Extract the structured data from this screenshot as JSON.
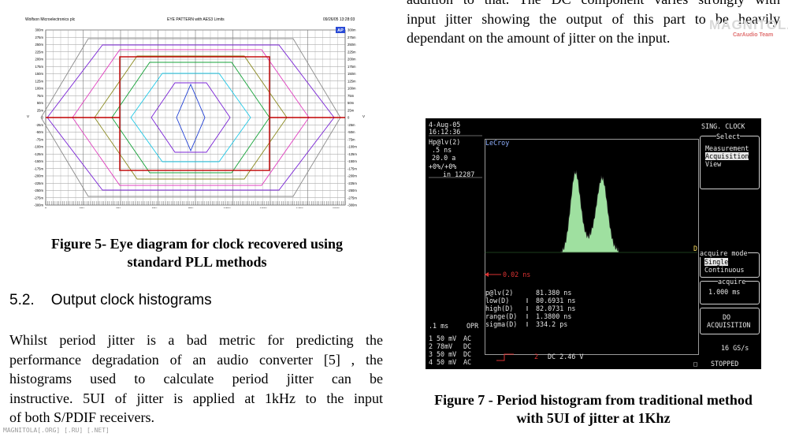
{
  "eye_diagram": {
    "header_left": "Wolfson Microelectronics plc",
    "header_center": "EYE PATTERN with AES3 Limits",
    "header_right": "09/26/05 13:28:03",
    "logo": "AP",
    "y_left_ticks": [
      "300m",
      "275m",
      "250m",
      "225m",
      "200m",
      "175m",
      "150m",
      "125m",
      "100m",
      "75m",
      "50m",
      "25m",
      "0",
      "-25m",
      "-50m",
      "-75m",
      "-100m",
      "-125m",
      "-150m",
      "-175m",
      "-200m",
      "-225m",
      "-250m",
      "-275m",
      "-300m"
    ],
    "y_right_ticks": [
      "300m",
      "275m",
      "250m",
      "225m",
      "200m",
      "175m",
      "150m",
      "125m",
      "100m",
      "75m",
      "50m",
      "25m",
      "0",
      "-25m",
      "-50m",
      "-75m",
      "-100m",
      "-125m",
      "-150m",
      "-175m",
      "-200m",
      "-225m",
      "-250m",
      "-275m",
      "-300m"
    ],
    "x_ticks": [
      "0",
      "20n",
      "40n",
      "60n",
      "80n",
      "100n",
      "120n",
      "140n",
      "160n"
    ],
    "y_axis_label_left": "V",
    "y_axis_label_right": "V",
    "x_axis_label": "sec",
    "colors": {
      "red": "#c00000",
      "blue": "#1f3fd6",
      "violet": "#7a24d6",
      "green": "#17a33a",
      "cyan": "#22c9e6",
      "olive": "#8a8a20",
      "gray": "#8c8c8c",
      "pink": "#e040c0"
    }
  },
  "figure5_caption": [
    "Figure 5- Eye diagram for clock recovered using",
    "standard PLL methods"
  ],
  "section_heading": "5.2.    Output clock histograms",
  "body_lines": [
    "Whilst period jitter is a bad metric for predicting the",
    "performance degradation of an audio converter [5] , the",
    "histograms used to calculate period jitter can be",
    "instructive. 5UI of jitter is applied at 1kHz to the input",
    "of both S/PDIF receivers."
  ],
  "top_text_lines": [
    "addition to that. The DC component varies strongly with",
    "input jitter showing the output of this  part to be heavily",
    "dependant on the amount of jitter on the input."
  ],
  "watermark_top": "MAGNITOLA",
  "watermark_sub": "CarAudio Team",
  "watermark_bottom": "MAGNITOLA[.ORG] [.RU] [.NET]",
  "scope": {
    "date": "4-Aug-05",
    "time": "16:12:36",
    "trace_param": "Hp@lv(2)",
    "param_val1": ".5 ns",
    "param_val2": "20.0 a",
    "param_range": "+0%/+0%",
    "param_count": "in 12287",
    "brand": "LeCroy",
    "mode_title": "SING. CLOCK",
    "menu_select_title": "Select",
    "menu_items": [
      "Measurement",
      "Acquisition",
      "View"
    ],
    "menu_selected": "Acquisition",
    "acquire_mode_title": "acquire mode",
    "acquire_modes": [
      "Single",
      "Continuous"
    ],
    "acquire_selected": "Single",
    "acquire_title": "acquire",
    "acquire_value": "1.000 ms",
    "do_acq_line1": "DO",
    "do_acq_line2": "ACQUISITION",
    "sample_rate": "16 GS/s",
    "status": "STOPPED",
    "cursor_label": "0.02 ns",
    "marker_d": "D",
    "stats": [
      {
        "label": "p@lv(2)",
        "value": "81.380 ns"
      },
      {
        "label": "low(D)",
        "value": "80.6931 ns"
      },
      {
        "label": "high(D)",
        "value": "82.0731 ns"
      },
      {
        "label": "range(D)",
        "value": "1.3800 ns"
      },
      {
        "label": "sigma(D)",
        "value": "334.2 ps"
      }
    ],
    "timebase": ".1 ms",
    "opr": "OPR",
    "channels": [
      {
        "num": "1",
        "volts": "50 mV",
        "coupling": "AC"
      },
      {
        "num": "2",
        "volts": "78mV",
        "coupling": "DC"
      },
      {
        "num": "3",
        "volts": "50 mV",
        "coupling": "DC"
      },
      {
        "num": "4",
        "volts": "50 mV",
        "coupling": "AC"
      }
    ],
    "trigger_channel": "2",
    "trigger_text": "DC 2.46 V",
    "histogram_color": "#9fe0a0",
    "histogram_outline": "#222222"
  },
  "figure7_caption": [
    "Figure 7 - Period histogram from traditional method",
    "with 5UI of jitter at 1Khz"
  ]
}
